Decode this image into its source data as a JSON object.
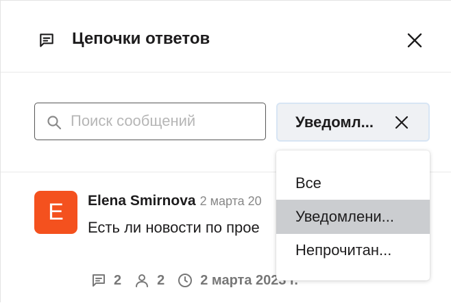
{
  "header": {
    "title": "Цепочки ответов",
    "icon": "threads-icon",
    "close_icon": "close-icon"
  },
  "search": {
    "placeholder": "Поиск сообщений",
    "value": ""
  },
  "filter": {
    "selected_label": "Уведомл...",
    "clear_icon": "close-icon",
    "options": [
      "Все",
      "Уведомлени...",
      "Непрочитан..."
    ],
    "selected_index": 1
  },
  "message": {
    "avatar_letter": "E",
    "avatar_color": "#f4511e",
    "author": "Elena Smirnova",
    "timestamp": "2 марта 20",
    "text": "Есть ли новости по прое",
    "reply_count": "2",
    "participant_count": "2",
    "last_reply_date": "2 марта 2023 г."
  },
  "colors": {
    "chip_background": "#eff1f4",
    "chip_border": "#d7e5f4",
    "selected_option": "#cbcdd0"
  }
}
